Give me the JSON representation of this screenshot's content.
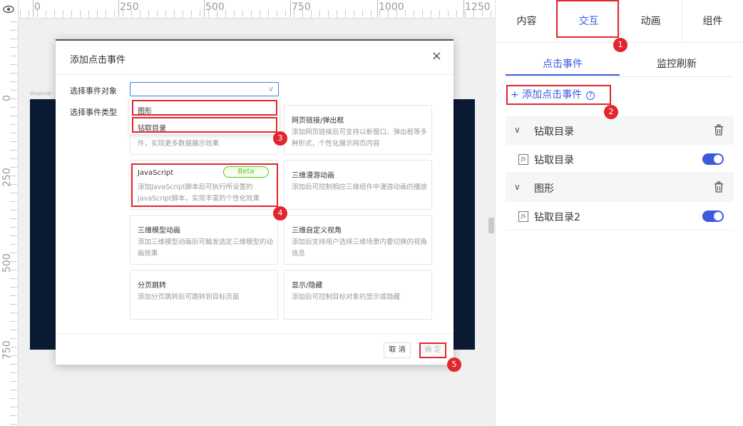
{
  "ruler": {
    "h_labels": [
      "0",
      "250",
      "500",
      "750",
      "1000",
      "1250"
    ],
    "v_labels": [
      "0",
      "250",
      "500",
      "750"
    ]
  },
  "canvas": {
    "tiny_label": "调出画布内数"
  },
  "modal": {
    "title": "添加点击事件",
    "close_icon": "×",
    "target_label": "选择事件对象",
    "type_label": "选择事件类型",
    "target_value": "",
    "dropdown_options": [
      "图形",
      "钻取目录"
    ],
    "cards": [
      {
        "title": "",
        "desc": "件，实现更多数据展示效果"
      },
      {
        "title": "网页链接/弹出框",
        "desc": "添加网页链接后可支持以新窗口、弹出框等多种形式，个性化展示网页内容"
      },
      {
        "title": "JavaScript",
        "desc": "添加JavaScript脚本后可执行所设置的JavaScript脚本，实现丰富的个性化效果",
        "badge": "Beta"
      },
      {
        "title": "三维漫游动画",
        "desc": "添加后可控制相应三维组件中漫游动画的播放"
      },
      {
        "title": "三维模型动画",
        "desc": "添加三维模型动画后可触发选定三维模型的动画效果"
      },
      {
        "title": "三维自定义视角",
        "desc": "添加后支持用户选择三维场景内要切换的视角信息"
      },
      {
        "title": "分页跳转",
        "desc": "添加分页跳转后可跳转到目标页面"
      },
      {
        "title": "显示/隐藏",
        "desc": "添加后可控制目标对象的显示或隐藏"
      }
    ],
    "cancel_label": "取 消",
    "ok_label": "确 定"
  },
  "steps": [
    "1",
    "2",
    "3",
    "4",
    "5"
  ],
  "right_panel": {
    "tabs": [
      "内容",
      "交互",
      "动画",
      "组件"
    ],
    "active_tab": "交互",
    "sub_tabs": [
      "点击事件",
      "监控刷新"
    ],
    "add_event_label": "+ 添加点击事件",
    "help_icon": "?",
    "groups": [
      {
        "chevron": "∨",
        "label": "钻取目录",
        "events": [
          {
            "icon": "JS",
            "label": "钻取目录",
            "enabled": true
          }
        ]
      },
      {
        "chevron": "∨",
        "label": "图形",
        "events": [
          {
            "icon": "JS",
            "label": "钻取目录2",
            "enabled": true
          }
        ]
      }
    ]
  },
  "colors": {
    "accent": "#3b5bdb",
    "highlight": "#e0262e",
    "canvas_dark": "#0b1a33",
    "beta_green": "#52c41a"
  }
}
